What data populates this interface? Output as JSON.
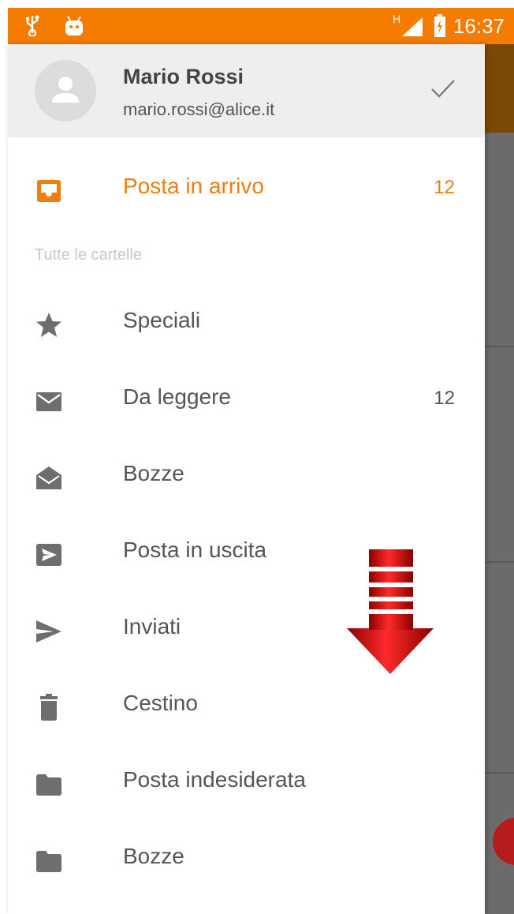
{
  "status_bar": {
    "time": "16:37",
    "network_label": "H",
    "background_color": "#f57c00",
    "icons": [
      "usb-icon",
      "android-icon",
      "signal-icon",
      "battery-icon"
    ]
  },
  "account": {
    "name": "Mario Rossi",
    "email": "mario.rossi@alice.it",
    "avatar_icon": "person-icon",
    "selected_icon": "check-icon"
  },
  "inbox": {
    "label": "Posta in arrivo",
    "count": "12",
    "icon": "inbox-icon",
    "accent_color": "#ef7d0f"
  },
  "section_header": "Tutte le cartelle",
  "folders": [
    {
      "label": "Speciali",
      "count": "",
      "icon": "star-icon"
    },
    {
      "label": "Da leggere",
      "count": "12",
      "icon": "mail-closed-icon"
    },
    {
      "label": "Bozze",
      "count": "",
      "icon": "mail-open-icon"
    },
    {
      "label": "Posta in uscita",
      "count": "",
      "icon": "outbox-icon"
    },
    {
      "label": "Inviati",
      "count": "",
      "icon": "send-icon"
    },
    {
      "label": "Cestino",
      "count": "",
      "icon": "trash-icon"
    },
    {
      "label": "Posta indesiderata",
      "count": "",
      "icon": "folder-icon"
    },
    {
      "label": "Bozze",
      "count": "",
      "icon": "folder-icon"
    }
  ],
  "overlay": {
    "icon": "scroll-down-arrow-icon",
    "color": "#d50000"
  }
}
